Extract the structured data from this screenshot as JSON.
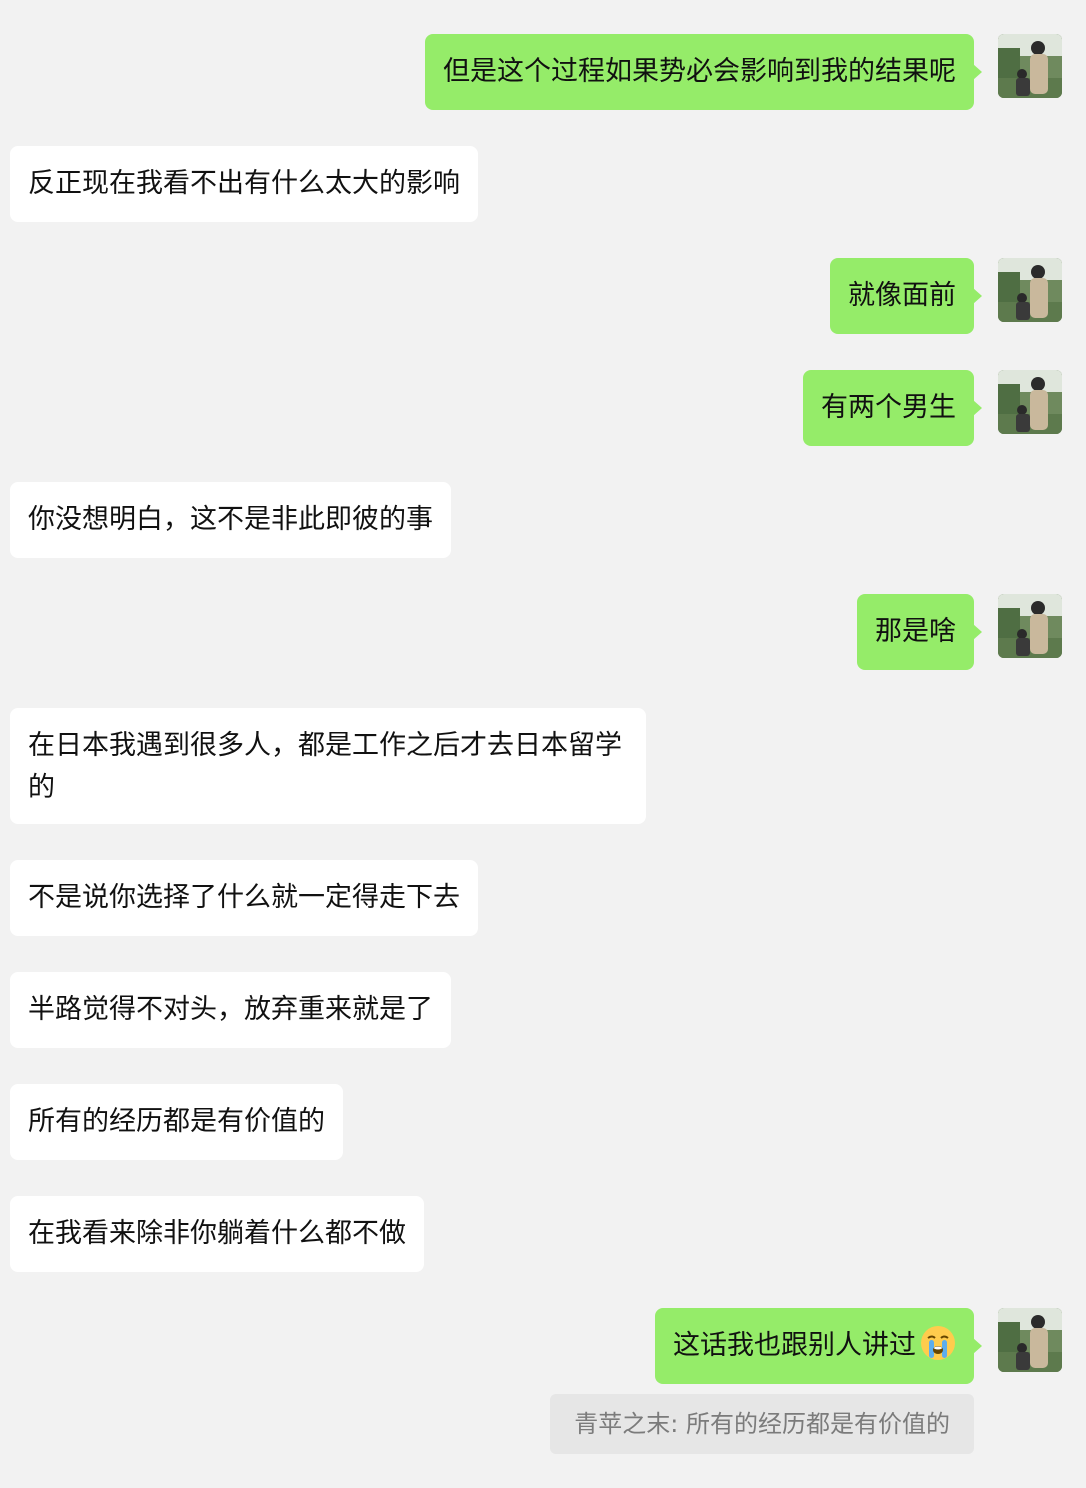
{
  "messages": [
    {
      "text": "但是这个过程如果势必会影响到我的结果呢"
    },
    {
      "text": "反正现在我看不出有什么太大的影响"
    },
    {
      "text": "就像面前"
    },
    {
      "text": "有两个男生"
    },
    {
      "text": "你没想明白，这不是非此即彼的事"
    },
    {
      "text": "那是啥"
    },
    {
      "text": "在日本我遇到很多人，都是工作之后才去日本留学的"
    },
    {
      "text": "不是说你选择了什么就一定得走下去"
    },
    {
      "text": "半路觉得不对头，放弃重来就是了"
    },
    {
      "text": "所有的经历都是有价值的"
    },
    {
      "text": "在我看来除非你躺着什么都不做"
    },
    {
      "text": "这话我也跟别人讲过",
      "emoji": "crying-face-emoji"
    }
  ],
  "quote": {
    "text": "青苹之末: 所有的经历都是有价值的"
  },
  "colors": {
    "background": "#f2f2f2",
    "outgoing_bubble": "#95ec69",
    "incoming_bubble": "#ffffff",
    "quote_bg": "#e6e6e6",
    "quote_text": "#7b7b7b"
  }
}
